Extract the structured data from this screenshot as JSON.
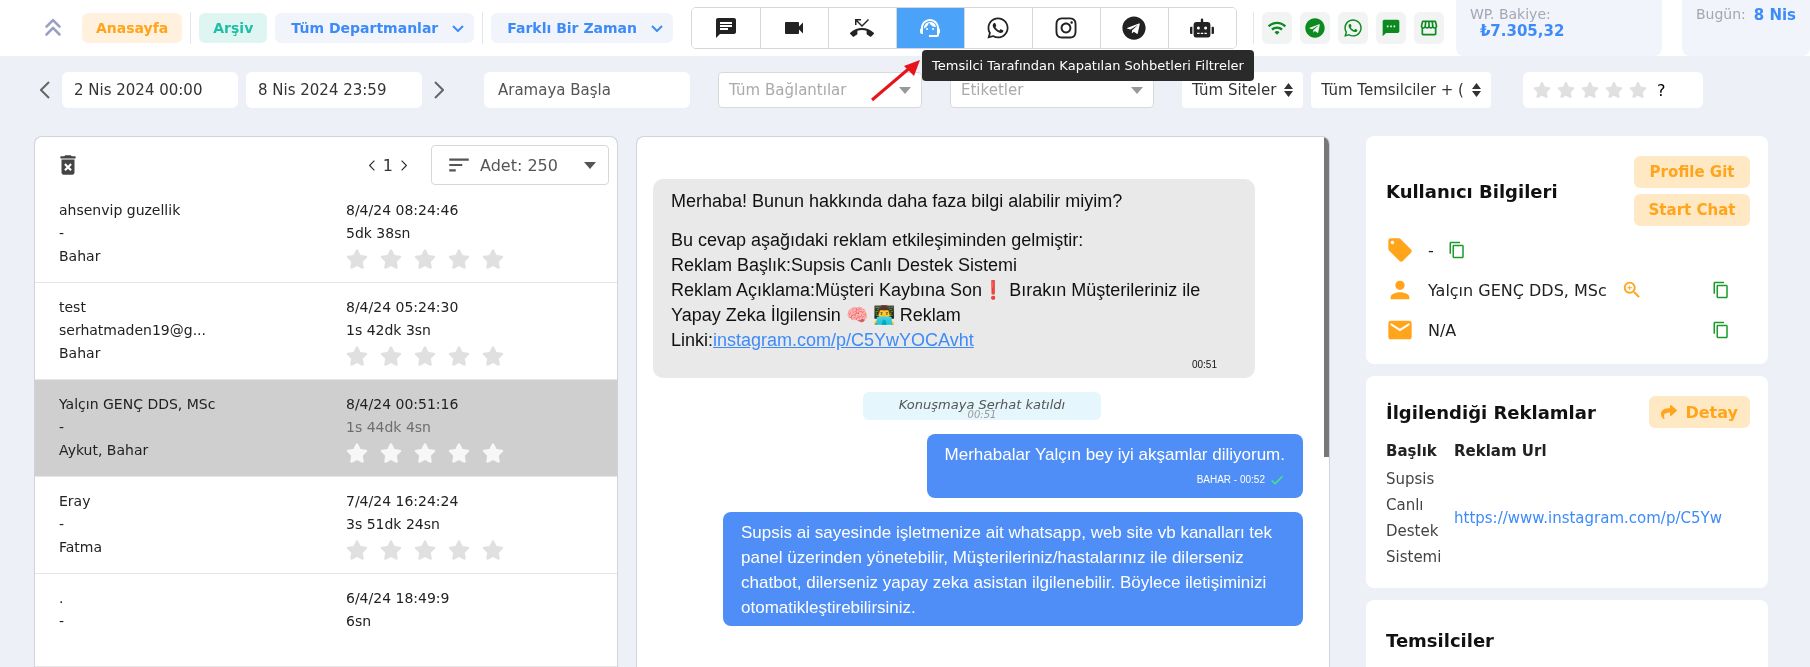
{
  "top_nav": {
    "items": [
      {
        "kind": "pill",
        "label": "Anasayfa",
        "color": "#ffa41b"
      },
      {
        "kind": "pill",
        "label": "Arşiv",
        "color": "#1fbfa7"
      },
      {
        "kind": "dropdown",
        "label": "Tüm Departmanlar"
      },
      {
        "kind": "dropdown",
        "label": "Farklı Bir Zaman"
      }
    ]
  },
  "channel_filters": [
    {
      "kind": "chat",
      "selected": false
    },
    {
      "kind": "video",
      "selected": false
    },
    {
      "kind": "missed-call",
      "selected": false
    },
    {
      "kind": "agent-closed",
      "selected": true
    },
    {
      "kind": "whatsapp",
      "selected": false
    },
    {
      "kind": "instagram",
      "selected": false
    },
    {
      "kind": "telegram",
      "selected": false
    },
    {
      "kind": "bot",
      "selected": false
    }
  ],
  "tooltip": "Temsilci Tarafından Kapatılan Sohbetleri Filtreler",
  "balance": {
    "label": "WP. Bakiye:",
    "value": "₺7.305,32"
  },
  "today": {
    "label": "Bugün:",
    "value": "8 Nis"
  },
  "filters": {
    "start": "2 Nis 2024 00:00",
    "end": "8 Nis 2024 23:59",
    "search_placeholder": "Aramaya Başla",
    "selects": [
      {
        "kind": "placeholder",
        "label": "Tüm Bağlantılar"
      },
      {
        "kind": "placeholder",
        "label": "Etiketler"
      },
      {
        "kind": "native",
        "label": "Tüm Siteler"
      },
      {
        "kind": "native",
        "label": "Tüm Temsilciler + ("
      }
    ],
    "rating": {
      "stars": 0,
      "help": "?"
    }
  },
  "conversations": {
    "page": "1",
    "count": "Adet: 250",
    "rows": [
      {
        "name": "ahsenvip guzellik",
        "contact": "-",
        "agents": "Bahar",
        "time": "8/4/24 08:24:46",
        "duration": "5dk 38sn",
        "stars": 0,
        "selected": false
      },
      {
        "name": "test",
        "contact": "serhatmaden19@g...",
        "agents": "Bahar",
        "time": "8/4/24 05:24:30",
        "duration": "1s 42dk 3sn",
        "stars": 0,
        "selected": false
      },
      {
        "name": "Yalçın GENÇ DDS, MSc",
        "contact": "-",
        "agents": "Aykut, Bahar",
        "time": "8/4/24 00:51:16",
        "duration": "1s 44dk 4sn",
        "stars": 0,
        "selected": true
      },
      {
        "name": "Eray",
        "contact": "-",
        "agents": "Fatma",
        "time": "7/4/24 16:24:24",
        "duration": "3s 51dk 24sn",
        "stars": 0,
        "selected": false
      },
      {
        "name": ".",
        "contact": "-",
        "time": "6/4/24 18:49:9",
        "duration": "6sn",
        "selected": false
      }
    ]
  },
  "messages": [
    {
      "kind": "incoming",
      "paragraphs": [
        "Merhaba! Bunun hakkında daha faza bilgi alabilir miyim?",
        "Bu cevap aşağıdaki reklam etkileşiminden gelmiştir:\nReklam Başlık:Supsis Canlı Destek Sistemi\nReklam Açıklama:Müşteri Kaybına Son❗ Bırakın Müşterileriniz ile Yapay Zeka İlgilensin 🧠 👨‍💻 Reklam Linki:"
      ],
      "link": "instagram.com/p/C5YwYOCAvht",
      "time": "00:51"
    },
    {
      "kind": "system",
      "text": "Konuşmaya Serhat katıldı",
      "time": "00:51"
    },
    {
      "kind": "outgoing",
      "text": "Merhabalar Yalçın bey iyi akşamlar diliyorum.",
      "meta": "BAHAR - 00:52",
      "read": true
    },
    {
      "kind": "outgoing",
      "text": "Supsis ai sayesinde işletmenize ait whatsapp, web site vb kanalları tek panel üzerinden yönetebilir, Müşterileriniz/hastalarınız ile dilerseniz chatbot, dilerseniz yapay zeka asistan ilgilenebilir. Böylece iletişiminizi otomatikleştirebilirsiniz.",
      "read": false
    }
  ],
  "user_info": {
    "title": "Kullanıcı Bilgileri",
    "buttons": [
      "Profile Git",
      "Start Chat"
    ],
    "rows": [
      {
        "kind": "tag",
        "value": "-",
        "lookup": false
      },
      {
        "kind": "person",
        "value": "Yalçın GENÇ DDS, MSc",
        "lookup": true
      },
      {
        "kind": "email",
        "value": "N/A",
        "lookup": false
      }
    ]
  },
  "ads": {
    "title": "İlgilendiği Reklamlar",
    "button": "Detay",
    "columns": [
      "Başlık",
      "Reklam Url"
    ],
    "rows": [
      {
        "title": "Supsis Canlı Destek Sistemi",
        "url": "https://www.instagram.com/p/C5Yw"
      }
    ]
  },
  "representatives": {
    "title": "Temsilciler"
  }
}
